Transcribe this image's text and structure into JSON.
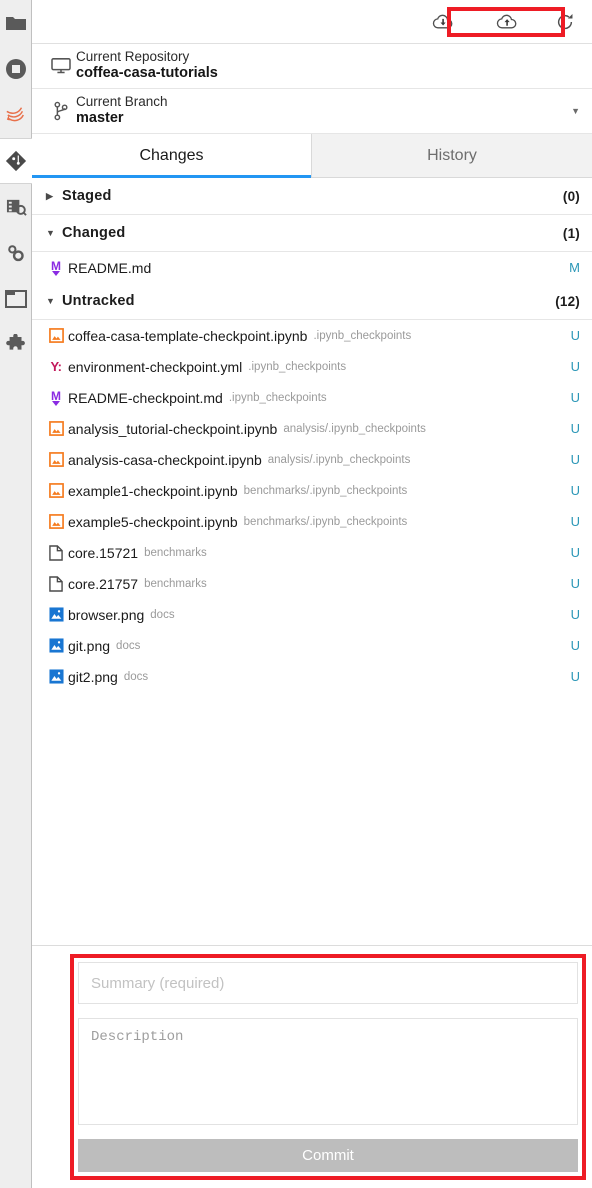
{
  "colors": {
    "accent_blue": "#2296f3",
    "highlight_red": "#ee1c25",
    "status_teal": "#2b97b7",
    "sidebar_bg": "#eeeeee",
    "commit_button_bg": "#bdbdbd"
  },
  "activitybar": {
    "items": [
      {
        "icon": "folder-icon",
        "active": false
      },
      {
        "icon": "stop-circle-icon",
        "active": false
      },
      {
        "icon": "jupyter-icon",
        "active": false
      },
      {
        "icon": "git-icon",
        "active": true
      },
      {
        "icon": "table-of-contents-icon",
        "active": false
      },
      {
        "icon": "gears-icon",
        "active": false
      },
      {
        "icon": "panel-icon",
        "active": false
      },
      {
        "icon": "extensions-puzzle-icon",
        "active": false
      }
    ]
  },
  "toolbar": {
    "pull_label": "Pull",
    "push_label": "Push",
    "refresh_label": "Refresh"
  },
  "repository": {
    "label": "Current Repository",
    "value": "coffea-casa-tutorials"
  },
  "branch": {
    "label": "Current Branch",
    "value": "master"
  },
  "tabs": [
    {
      "label": "Changes",
      "active": true
    },
    {
      "label": "History",
      "active": false
    }
  ],
  "sections": [
    {
      "name": "staged",
      "title": "Staged",
      "count": "(0)",
      "expanded": false,
      "files": []
    },
    {
      "name": "changed",
      "title": "Changed",
      "count": "(1)",
      "expanded": true,
      "files": [
        {
          "icon": "markdown-file-icon",
          "name": "README.md",
          "path": "",
          "status": "M"
        }
      ]
    },
    {
      "name": "untracked",
      "title": "Untracked",
      "count": "(12)",
      "expanded": true,
      "files": [
        {
          "icon": "notebook-file-icon",
          "name": "coffea-casa-template-checkpoint.ipynb",
          "path": ".ipynb_checkpoints",
          "status": "U"
        },
        {
          "icon": "yaml-file-icon",
          "name": "environment-checkpoint.yml",
          "path": ".ipynb_checkpoints",
          "status": "U"
        },
        {
          "icon": "markdown-file-icon",
          "name": "README-checkpoint.md",
          "path": ".ipynb_checkpoints",
          "status": "U"
        },
        {
          "icon": "notebook-file-icon",
          "name": "analysis_tutorial-checkpoint.ipynb",
          "path": "analysis/.ipynb_checkpoints",
          "status": "U"
        },
        {
          "icon": "notebook-file-icon",
          "name": "analysis-casa-checkpoint.ipynb",
          "path": "analysis/.ipynb_checkpoints",
          "status": "U"
        },
        {
          "icon": "notebook-file-icon",
          "name": "example1-checkpoint.ipynb",
          "path": "benchmarks/.ipynb_checkpoints",
          "status": "U"
        },
        {
          "icon": "notebook-file-icon",
          "name": "example5-checkpoint.ipynb",
          "path": "benchmarks/.ipynb_checkpoints",
          "status": "U"
        },
        {
          "icon": "plain-file-icon",
          "name": "core.15721",
          "path": "benchmarks",
          "status": "U"
        },
        {
          "icon": "plain-file-icon",
          "name": "core.21757",
          "path": "benchmarks",
          "status": "U"
        },
        {
          "icon": "image-file-icon",
          "name": "browser.png",
          "path": "docs",
          "status": "U"
        },
        {
          "icon": "image-file-icon",
          "name": "git.png",
          "path": "docs",
          "status": "U"
        },
        {
          "icon": "image-file-icon",
          "name": "git2.png",
          "path": "docs",
          "status": "U"
        }
      ]
    }
  ],
  "commit": {
    "summary_value": "",
    "summary_placeholder": "Summary (required)",
    "description_value": "",
    "description_placeholder": "Description",
    "button_label": "Commit"
  }
}
